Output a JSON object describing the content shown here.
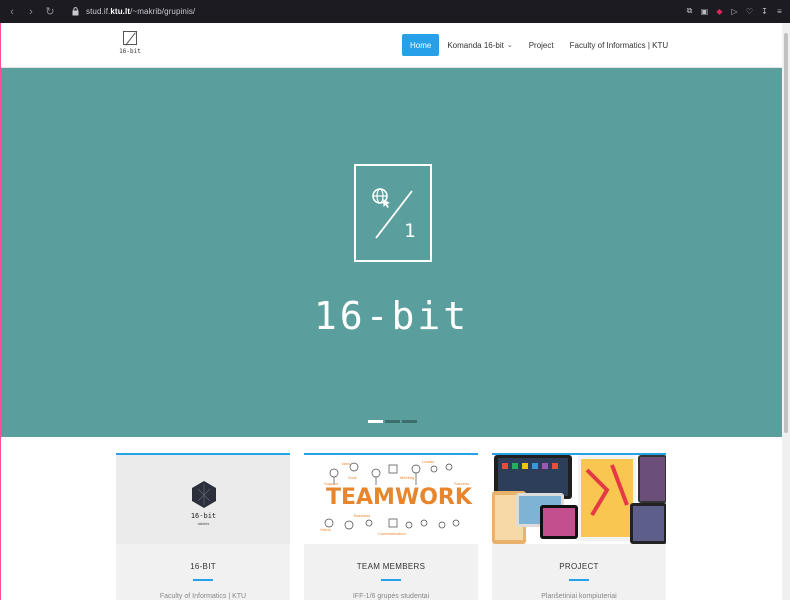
{
  "browser": {
    "url_prefix": "stud.if.",
    "url_domain": "ktu.lt",
    "url_path": "/~makrib/grupinis/",
    "icons": [
      "back-icon",
      "forward-icon",
      "reload-icon",
      "lock-icon",
      "share-icon",
      "screenshot-icon",
      "shield-icon",
      "send-icon",
      "heart-icon",
      "download-icon",
      "menu-icon"
    ]
  },
  "site": {
    "logo_text": "16-bit",
    "nav": [
      {
        "label": "Home",
        "active": true
      },
      {
        "label": "Komanda 16-bit",
        "dropdown": true
      },
      {
        "label": "Project"
      },
      {
        "label": "Faculty of Informatics | KTU"
      }
    ]
  },
  "hero": {
    "emblem_number": "1",
    "title": "16-bit",
    "slides_total": 3,
    "slide_active": 1
  },
  "cards": [
    {
      "image_title": "16-bit",
      "image_subtitle": "tablets",
      "title": "16-BIT",
      "desc": "Faculty of Informatics | KTU"
    },
    {
      "image_word": "TEAMWORK",
      "image_tags": [
        "Idea",
        "Goal",
        "Meeting",
        "Leader",
        "Support",
        "Success",
        "Business",
        "Vision",
        "Communication"
      ],
      "title": "TEAM MEMBERS",
      "desc": "IFF-1/6 grupės studentai"
    },
    {
      "title": "PROJECT",
      "desc": "Planšetiniai kompiuteriai"
    }
  ],
  "colors": {
    "accent": "#26a0e8",
    "hero_bg": "#5a9f9d",
    "chrome_bg": "#1c1b22",
    "teamwork_orange": "#e8862e"
  }
}
